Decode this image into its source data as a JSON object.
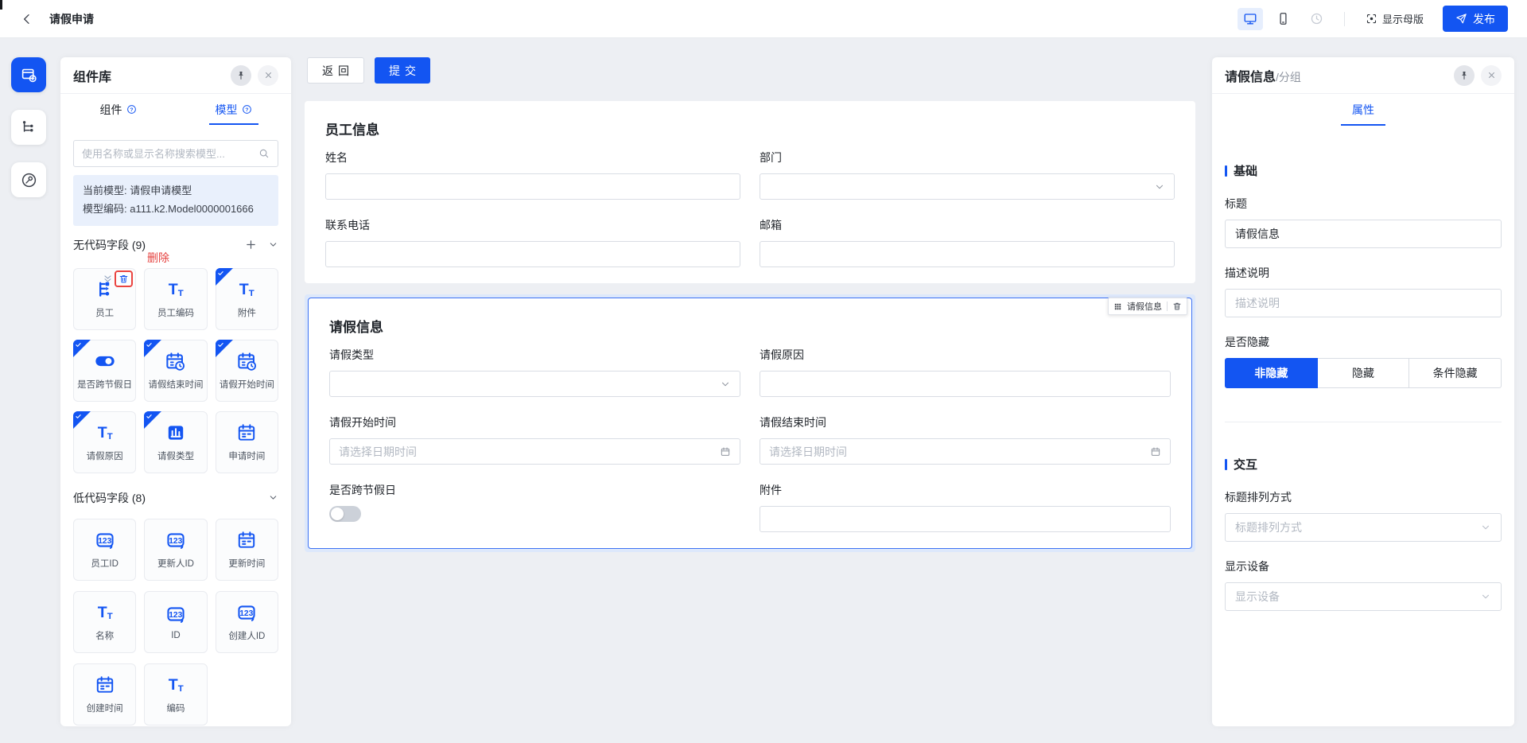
{
  "topbar": {
    "title": "请假申请",
    "master_button": "显示母版",
    "publish_button": "发布"
  },
  "library": {
    "title": "组件库",
    "tab_component": "组件",
    "tab_model": "模型",
    "search_placeholder": "使用名称或显示名称搜索模型...",
    "model_line1": "当前模型: 请假申请模型",
    "model_line2": "模型编码: a111.k2.Model0000001666",
    "delete_annotation": "删除",
    "nocode_header": "无代码字段 (9)",
    "lowcode_header": "低代码字段 (8)",
    "nocode_fields": [
      {
        "label": "员工",
        "icon": "relation-icon",
        "selected": false
      },
      {
        "label": "员工编码",
        "icon": "text-icon",
        "selected": false
      },
      {
        "label": "附件",
        "icon": "text-icon",
        "selected": true
      },
      {
        "label": "是否跨节假日",
        "icon": "toggle-icon",
        "selected": true
      },
      {
        "label": "请假结束时间",
        "icon": "calendar-clock-icon",
        "selected": true
      },
      {
        "label": "请假开始时间",
        "icon": "calendar-clock-icon",
        "selected": true
      },
      {
        "label": "请假原因",
        "icon": "text-icon",
        "selected": true
      },
      {
        "label": "请假类型",
        "icon": "category-icon",
        "selected": true
      },
      {
        "label": "申请时间",
        "icon": "calendar-icon",
        "selected": false
      }
    ],
    "lowcode_fields": [
      {
        "label": "员工ID",
        "icon": "number-icon"
      },
      {
        "label": "更新人ID",
        "icon": "number-icon"
      },
      {
        "label": "更新时间",
        "icon": "calendar-icon"
      },
      {
        "label": "名称",
        "icon": "text-icon"
      },
      {
        "label": "ID",
        "icon": "number-icon"
      },
      {
        "label": "创建人ID",
        "icon": "number-icon"
      },
      {
        "label": "创建时间",
        "icon": "calendar-icon"
      },
      {
        "label": "编码",
        "icon": "text-icon"
      }
    ]
  },
  "canvas": {
    "back_button": "返回",
    "submit_button": "提交",
    "employee_section": {
      "title": "员工信息",
      "fields": [
        {
          "label": "姓名",
          "type": "input"
        },
        {
          "label": "部门",
          "type": "select"
        },
        {
          "label": "联系电话",
          "type": "input"
        },
        {
          "label": "邮箱",
          "type": "input"
        }
      ]
    },
    "leave_section": {
      "title": "请假信息",
      "badge_label": "请假信息",
      "fields": [
        {
          "label": "请假类型",
          "type": "select"
        },
        {
          "label": "请假原因",
          "type": "input"
        },
        {
          "label": "请假开始时间",
          "type": "date",
          "placeholder": "请选择日期时间"
        },
        {
          "label": "请假结束时间",
          "type": "date",
          "placeholder": "请选择日期时间"
        },
        {
          "label": "是否跨节假日",
          "type": "switch",
          "value": "off"
        },
        {
          "label": "附件",
          "type": "input"
        }
      ]
    }
  },
  "inspector": {
    "title": "请假信息",
    "subtitle": "/分组",
    "tab_properties": "属性",
    "basic_section": "基础",
    "interaction_section": "交互",
    "title_label": "标题",
    "title_value": "请假信息",
    "description_label": "描述说明",
    "description_placeholder": "描述说明",
    "hidden_label": "是否隐藏",
    "hidden_options": [
      "非隐藏",
      "隐藏",
      "条件隐藏"
    ],
    "hidden_selected": "非隐藏",
    "arrangement_label": "标题排列方式",
    "arrangement_placeholder": "标题排列方式",
    "device_label": "显示设备",
    "device_placeholder": "显示设备"
  },
  "colors": {
    "primary": "#1355f2",
    "danger": "#e5413f",
    "selection_bg": "#dde8fb"
  }
}
